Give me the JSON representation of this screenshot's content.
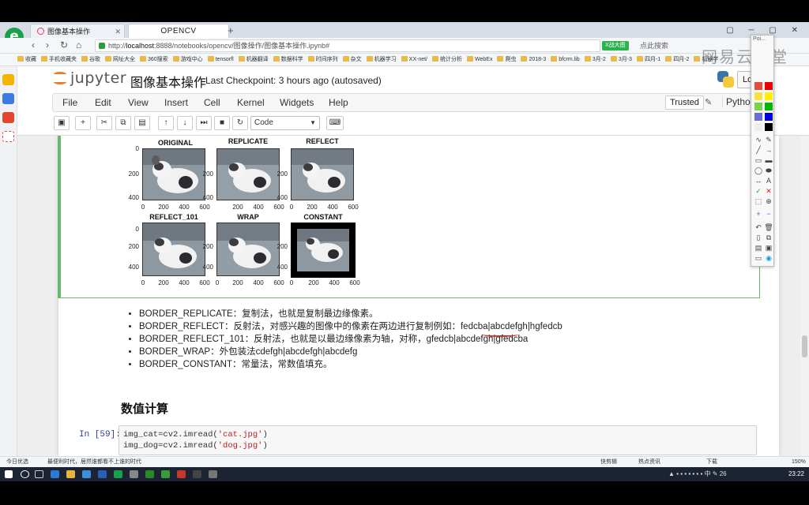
{
  "browser": {
    "tabs": [
      {
        "label": "图像基本操作"
      },
      {
        "label": "OPENCV"
      }
    ],
    "new_tab": "+",
    "url_prefix": "http://",
    "url_host": "localhost",
    "url_path": ":8888/notebooks/opencv/图像操作/图像基本操作.ipynb#",
    "badge": "X战大图",
    "addr_extra": "点此搜索",
    "bookmarks": [
      "收藏",
      "手机收藏夹",
      "谷歌",
      "网址大全",
      "360搜索",
      "游戏中心",
      "tensorfl",
      "机器翻译",
      "数据科学",
      "时间序列",
      "杂文",
      "机器学习",
      "XX-net/",
      "统计分析",
      "WebEx",
      "爬虫",
      "2018-3",
      "bfcrm.lib",
      "3月-2",
      "3月-3",
      "四月-1",
      "四月-2",
      "机器学"
    ]
  },
  "jupyter": {
    "brand": "jupyter",
    "notebook_title": "图像基本操作",
    "checkpoint": "Last Checkpoint: 3 hours ago (autosaved)",
    "logout": "Lo",
    "menu": [
      "File",
      "Edit",
      "View",
      "Insert",
      "Cell",
      "Kernel",
      "Widgets",
      "Help"
    ],
    "trusted": "Trusted",
    "kernel": "Python",
    "cell_type": "Code",
    "toolbar_icons": [
      "save-icon",
      "plus-icon",
      "cut-icon",
      "copy-icon",
      "paste-icon",
      "arrow-up-icon",
      "arrow-down-icon",
      "run-icon",
      "stop-icon",
      "restart-icon"
    ]
  },
  "figure": {
    "subplots": [
      {
        "title": "ORIGINAL"
      },
      {
        "title": "REPLICATE"
      },
      {
        "title": "REFLECT"
      },
      {
        "title": "REFLECT_101"
      },
      {
        "title": "WRAP"
      },
      {
        "title": "CONSTANT"
      }
    ],
    "yticks": [
      "0",
      "200",
      "400"
    ],
    "xticks": [
      "0",
      "200",
      "400",
      "600"
    ]
  },
  "markdown": {
    "items": [
      "BORDER_REPLICATE：复制法，也就是复制最边缘像素。",
      "BORDER_REFLECT：反射法，对感兴趣的图像中的像素在两边进行复制例如：fedcba|abcdefgh|hgfedcb",
      "BORDER_REFLECT_101：反射法，也就是以最边缘像素为轴，对称，gfedcb|abcdefgh|gfedcba",
      "BORDER_WRAP：外包装法cdefgh|abcdefgh|abcdefg",
      "BORDER_CONSTANT：常量法，常数值填充。"
    ],
    "heading": "数值计算"
  },
  "code_cell": {
    "prompt": "In [59]:",
    "line1_a": "img_cat=cv2.imread(",
    "line1_s": "'cat.jpg'",
    "line1_b": ")",
    "line2_a": "img_dog=cv2.imread(",
    "line2_s": "'dog.jpg'",
    "line2_b": ")"
  },
  "watermark": "网易云课堂",
  "palette_title": "Poi...",
  "statusbar": {
    "left": "今日优选",
    "news": "最便利时代，居然谁都看不上谁的时代",
    "right1": "快剪辑",
    "right2": "热点资讯",
    "right3": "下载",
    "zoom": "150%"
  },
  "taskbar": {
    "time": "23:22",
    "lang": "中",
    "badge": "26"
  }
}
